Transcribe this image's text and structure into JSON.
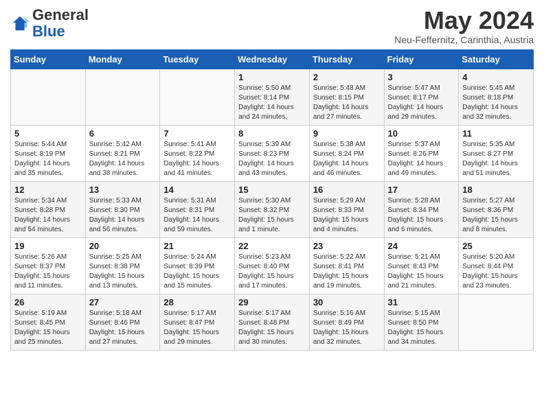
{
  "header": {
    "logo_general": "General",
    "logo_blue": "Blue",
    "month_title": "May 2024",
    "subtitle": "Neu-Feffernitz, Carinthia, Austria"
  },
  "weekdays": [
    "Sunday",
    "Monday",
    "Tuesday",
    "Wednesday",
    "Thursday",
    "Friday",
    "Saturday"
  ],
  "weeks": [
    [
      {
        "day": "",
        "info": ""
      },
      {
        "day": "",
        "info": ""
      },
      {
        "day": "",
        "info": ""
      },
      {
        "day": "1",
        "info": "Sunrise: 5:50 AM\nSunset: 8:14 PM\nDaylight: 14 hours\nand 24 minutes."
      },
      {
        "day": "2",
        "info": "Sunrise: 5:48 AM\nSunset: 8:15 PM\nDaylight: 14 hours\nand 27 minutes."
      },
      {
        "day": "3",
        "info": "Sunrise: 5:47 AM\nSunset: 8:17 PM\nDaylight: 14 hours\nand 29 minutes."
      },
      {
        "day": "4",
        "info": "Sunrise: 5:45 AM\nSunset: 8:18 PM\nDaylight: 14 hours\nand 32 minutes."
      }
    ],
    [
      {
        "day": "5",
        "info": "Sunrise: 5:44 AM\nSunset: 8:19 PM\nDaylight: 14 hours\nand 35 minutes."
      },
      {
        "day": "6",
        "info": "Sunrise: 5:42 AM\nSunset: 8:21 PM\nDaylight: 14 hours\nand 38 minutes."
      },
      {
        "day": "7",
        "info": "Sunrise: 5:41 AM\nSunset: 8:22 PM\nDaylight: 14 hours\nand 41 minutes."
      },
      {
        "day": "8",
        "info": "Sunrise: 5:39 AM\nSunset: 8:23 PM\nDaylight: 14 hours\nand 43 minutes."
      },
      {
        "day": "9",
        "info": "Sunrise: 5:38 AM\nSunset: 8:24 PM\nDaylight: 14 hours\nand 46 minutes."
      },
      {
        "day": "10",
        "info": "Sunrise: 5:37 AM\nSunset: 8:26 PM\nDaylight: 14 hours\nand 49 minutes."
      },
      {
        "day": "11",
        "info": "Sunrise: 5:35 AM\nSunset: 8:27 PM\nDaylight: 14 hours\nand 51 minutes."
      }
    ],
    [
      {
        "day": "12",
        "info": "Sunrise: 5:34 AM\nSunset: 8:28 PM\nDaylight: 14 hours\nand 54 minutes."
      },
      {
        "day": "13",
        "info": "Sunrise: 5:33 AM\nSunset: 8:30 PM\nDaylight: 14 hours\nand 56 minutes."
      },
      {
        "day": "14",
        "info": "Sunrise: 5:31 AM\nSunset: 8:31 PM\nDaylight: 14 hours\nand 59 minutes."
      },
      {
        "day": "15",
        "info": "Sunrise: 5:30 AM\nSunset: 8:32 PM\nDaylight: 15 hours\nand 1 minute."
      },
      {
        "day": "16",
        "info": "Sunrise: 5:29 AM\nSunset: 8:33 PM\nDaylight: 15 hours\nand 4 minutes."
      },
      {
        "day": "17",
        "info": "Sunrise: 5:28 AM\nSunset: 8:34 PM\nDaylight: 15 hours\nand 6 minutes."
      },
      {
        "day": "18",
        "info": "Sunrise: 5:27 AM\nSunset: 8:36 PM\nDaylight: 15 hours\nand 8 minutes."
      }
    ],
    [
      {
        "day": "19",
        "info": "Sunrise: 5:26 AM\nSunset: 8:37 PM\nDaylight: 15 hours\nand 11 minutes."
      },
      {
        "day": "20",
        "info": "Sunrise: 5:25 AM\nSunset: 8:38 PM\nDaylight: 15 hours\nand 13 minutes."
      },
      {
        "day": "21",
        "info": "Sunrise: 5:24 AM\nSunset: 8:39 PM\nDaylight: 15 hours\nand 15 minutes."
      },
      {
        "day": "22",
        "info": "Sunrise: 5:23 AM\nSunset: 8:40 PM\nDaylight: 15 hours\nand 17 minutes."
      },
      {
        "day": "23",
        "info": "Sunrise: 5:22 AM\nSunset: 8:41 PM\nDaylight: 15 hours\nand 19 minutes."
      },
      {
        "day": "24",
        "info": "Sunrise: 5:21 AM\nSunset: 8:43 PM\nDaylight: 15 hours\nand 21 minutes."
      },
      {
        "day": "25",
        "info": "Sunrise: 5:20 AM\nSunset: 8:44 PM\nDaylight: 15 hours\nand 23 minutes."
      }
    ],
    [
      {
        "day": "26",
        "info": "Sunrise: 5:19 AM\nSunset: 8:45 PM\nDaylight: 15 hours\nand 25 minutes."
      },
      {
        "day": "27",
        "info": "Sunrise: 5:18 AM\nSunset: 8:46 PM\nDaylight: 15 hours\nand 27 minutes."
      },
      {
        "day": "28",
        "info": "Sunrise: 5:17 AM\nSunset: 8:47 PM\nDaylight: 15 hours\nand 29 minutes."
      },
      {
        "day": "29",
        "info": "Sunrise: 5:17 AM\nSunset: 8:48 PM\nDaylight: 15 hours\nand 30 minutes."
      },
      {
        "day": "30",
        "info": "Sunrise: 5:16 AM\nSunset: 8:49 PM\nDaylight: 15 hours\nand 32 minutes."
      },
      {
        "day": "31",
        "info": "Sunrise: 5:15 AM\nSunset: 8:50 PM\nDaylight: 15 hours\nand 34 minutes."
      },
      {
        "day": "",
        "info": ""
      }
    ]
  ]
}
